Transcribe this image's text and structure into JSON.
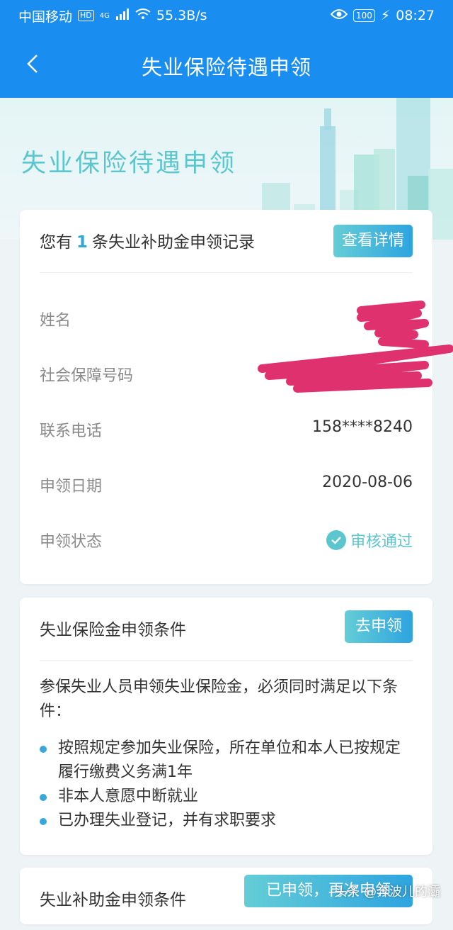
{
  "status_bar": {
    "carrier": "中国移动",
    "hd": "HD",
    "net": "4G",
    "speed": "55.3B/s",
    "battery": "100",
    "time": "08:27"
  },
  "nav": {
    "title": "失业保险待遇申领"
  },
  "hero": {
    "title": "失业保险待遇申领"
  },
  "record_card": {
    "prefix": "您有",
    "count": "1",
    "suffix": "条失业补助金申领记录",
    "button": "查看详情",
    "rows": [
      {
        "label": "姓名",
        "value": ""
      },
      {
        "label": "社会保障号码",
        "value": ""
      },
      {
        "label": "联系电话",
        "value": "158****8240"
      },
      {
        "label": "申领日期",
        "value": "2020-08-06"
      },
      {
        "label": "申领状态",
        "value": "审核通过"
      }
    ]
  },
  "conditions_card": {
    "title": "失业保险金申领条件",
    "button": "去申领",
    "desc": "参保失业人员申领失业保险金，必须同时满足以下条件：",
    "items": [
      "按照规定参加失业保险，所在单位和本人已按规定履行缴费义务满1年",
      "非本人意愿中断就业",
      "已办理失业登记，并有求职要求"
    ]
  },
  "subsidy_card": {
    "title": "失业补助金申领条件",
    "button": "已申领，再次申领"
  },
  "watermark": "头条 @奔波儿的灞",
  "colors": {
    "primary": "#1a8ef0",
    "accent": "#5cc6cf",
    "redaction": "#e0316f"
  }
}
